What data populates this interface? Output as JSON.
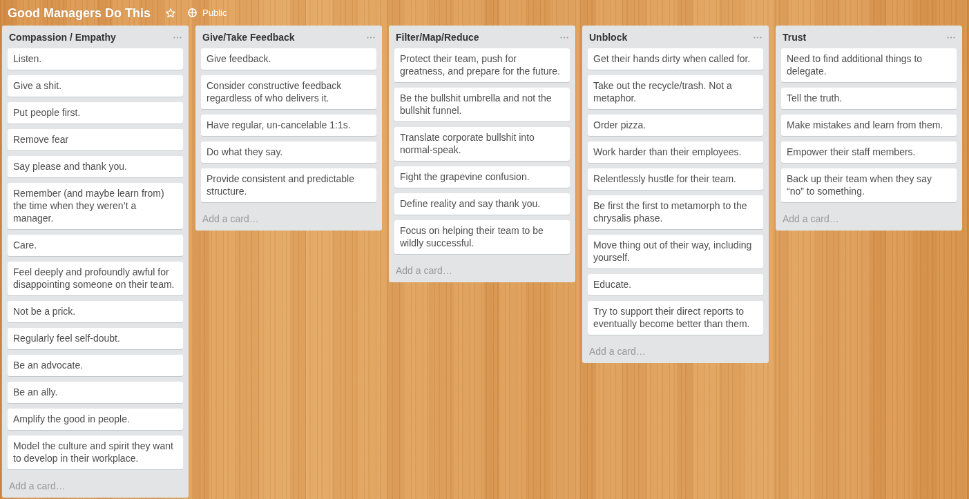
{
  "board": {
    "title": "Good Managers Do This",
    "starred": false,
    "visibility": "Public"
  },
  "lists": [
    {
      "title": "Compassion / Empathy",
      "cards": [
        "Listen.",
        "Give a shit.",
        "Put people first.",
        "Remove fear",
        "Say please and thank you.",
        "Remember (and maybe learn from) the time when they weren’t a manager.",
        "Care.",
        "Feel deeply and profoundly awful for disappointing someone on their team.",
        "Not be a prick.",
        "Regularly feel self-doubt.",
        "Be an advocate.",
        "Be an ally.",
        "Amplify the good in people.",
        "Model the culture and spirit they want to develop in their workplace."
      ],
      "add_card": "Add a card…"
    },
    {
      "title": "Give/Take Feedback",
      "cards": [
        "Give feedback.",
        "Consider constructive feedback regardless of who delivers it.",
        "Have regular, un-cancelable 1:1s.",
        "Do what they say.",
        "Provide consistent and predictable structure."
      ],
      "add_card": "Add a card…"
    },
    {
      "title": "Filter/Map/Reduce",
      "cards": [
        "Protect their team, push for greatness, and prepare for the future.",
        "Be the bullshit umbrella and not the bullshit funnel.",
        "Translate corporate bullshit into normal-speak.",
        "Fight the grapevine confusion.",
        "Define reality and say thank you.",
        "Focus on helping their team to be wildly successful."
      ],
      "add_card": "Add a card…"
    },
    {
      "title": "Unblock",
      "cards": [
        "Get their hands dirty when called for.",
        "Take out the recycle/trash. Not a metaphor.",
        "Order pizza.",
        "Work harder than their employees.",
        "Relentlessly hustle for their team.",
        "Be first the first to metamorph to the chrysalis phase.",
        "Move thing out of their way, including yourself.",
        "Educate.",
        "Try to support their direct reports to eventually become better than them."
      ],
      "add_card": "Add a card…"
    },
    {
      "title": "Trust",
      "cards": [
        "Need to find additional things to delegate.",
        "Tell the truth.",
        "Make mistakes and learn from them.",
        "Empower their staff members.",
        "Back up their team when they say “no” to something."
      ],
      "add_card": "Add a card…"
    }
  ]
}
